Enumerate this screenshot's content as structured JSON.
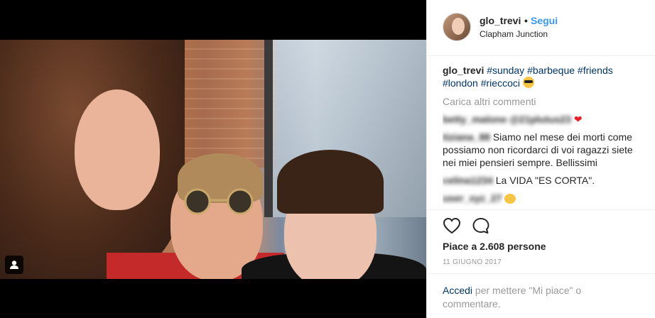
{
  "post": {
    "username": "glo_trevi",
    "separator": "•",
    "follow_label": "Segui",
    "location": "Clapham Junction"
  },
  "caption": {
    "username": "glo_trevi",
    "hashtags": [
      "#sunday",
      "#barbeque",
      "#friends",
      "#london",
      "#rieccoci"
    ],
    "emoji_icon": "sunglasses-emoji-icon"
  },
  "comments": {
    "load_more": "Carica altri commenti",
    "items": [
      {
        "user": "betty_malone",
        "text": "",
        "reaction_icon": "red-heart-icon"
      },
      {
        "user": "tiziana_88",
        "text": "Siamo nel mese dei morti come possiamo non ricordarci di voi ragazzi siete nei miei pensieri sempre. Bellissimi"
      },
      {
        "user": "celina1234",
        "text": "La VIDA \"ES CORTA\"."
      }
    ]
  },
  "actions": {
    "like_icon": "heart-outline-icon",
    "comment_icon": "speech-bubble-icon",
    "likes_text": "Piace a 2.608 persone",
    "date": "11 GIUGNO 2017"
  },
  "login_prompt": {
    "link": "Accedi",
    "text": "per mettere \"Mi piace\" o commentare."
  },
  "colors": {
    "link_blue": "#3897f0",
    "hashtag_blue": "#003569",
    "muted_gray": "#999999"
  }
}
